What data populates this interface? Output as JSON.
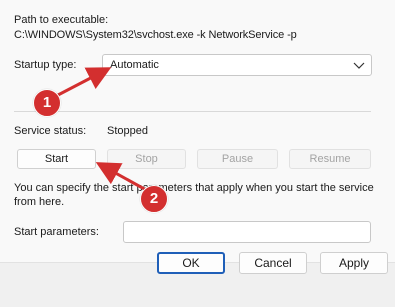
{
  "details": {
    "path_label": "Path to executable:",
    "path_value": "C:\\WINDOWS\\System32\\svchost.exe -k NetworkService -p",
    "startup_type_label": "Startup type:",
    "startup_type_value": "Automatic",
    "service_status_label": "Service status:",
    "service_status_value": "Stopped",
    "start_params_hint": "You can specify the start parameters that apply when you start the service from here.",
    "start_params_label": "Start parameters:",
    "start_params_value": ""
  },
  "service_buttons": {
    "start": "Start",
    "stop": "Stop",
    "pause": "Pause",
    "resume": "Resume"
  },
  "footer": {
    "ok": "OK",
    "cancel": "Cancel",
    "apply": "Apply"
  },
  "annotations": {
    "badge_1": "1",
    "badge_2": "2",
    "color": "#d32f2f"
  }
}
